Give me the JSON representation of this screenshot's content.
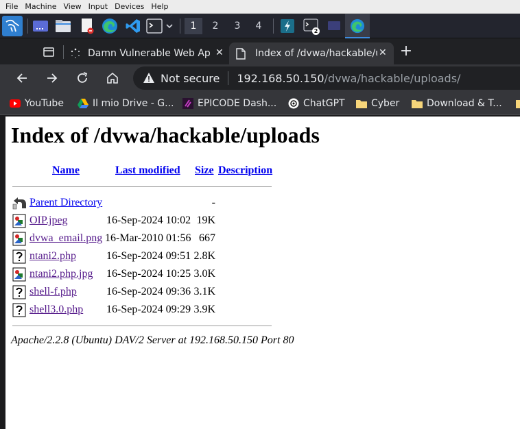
{
  "vm_menu": [
    "File",
    "Machine",
    "View",
    "Input",
    "Devices",
    "Help"
  ],
  "panel": {
    "workspaces": [
      "1",
      "2",
      "3",
      "4"
    ],
    "active_workspace": "1",
    "terminal_badge": "2"
  },
  "browser": {
    "tabs": [
      {
        "title": "Damn Vulnerable Web App"
      },
      {
        "title": "Index of /dvwa/hackable/uploads/"
      }
    ],
    "new_tab": "+",
    "security_label": "Not secure",
    "url_host": "192.168.50.150",
    "url_path": "/dvwa/hackable/uploads/",
    "bookmarks": [
      {
        "label": "YouTube",
        "icon": "youtube-icon"
      },
      {
        "label": "Il mio Drive - G...",
        "icon": "drive-icon"
      },
      {
        "label": "EPICODE Dash...",
        "icon": "epicode-icon"
      },
      {
        "label": "ChatGPT",
        "icon": "chatgpt-icon"
      },
      {
        "label": "Cyber",
        "icon": "folder-icon"
      },
      {
        "label": "Download & T...",
        "icon": "folder-icon"
      }
    ]
  },
  "page": {
    "title": "Index of /dvwa/hackable/uploads",
    "columns": {
      "name": "Name",
      "modified": "Last modified",
      "size": "Size",
      "description": "Description"
    },
    "rows": [
      {
        "name": "Parent Directory",
        "modified": "",
        "size": "-",
        "icon": "back-folder-icon"
      },
      {
        "name": "OIP.jpeg",
        "modified": "16-Sep-2024 10:02",
        "size": "19K",
        "icon": "image-file-icon"
      },
      {
        "name": "dvwa_email.png",
        "modified": "16-Mar-2010 01:56",
        "size": "667",
        "icon": "image-file-icon"
      },
      {
        "name": "ntani2.php",
        "modified": "16-Sep-2024 09:51",
        "size": "2.8K",
        "icon": "unknown-file-icon"
      },
      {
        "name": "ntani2.php.jpg",
        "modified": "16-Sep-2024 10:25",
        "size": "3.0K",
        "icon": "image-file-icon"
      },
      {
        "name": "shell-f.php",
        "modified": "16-Sep-2024 09:36",
        "size": "3.1K",
        "icon": "unknown-file-icon"
      },
      {
        "name": "shell3.0.php",
        "modified": "16-Sep-2024 09:29",
        "size": "3.9K",
        "icon": "unknown-file-icon"
      }
    ],
    "server_signature": "Apache/2.2.8 (Ubuntu) DAV/2 Server at 192.168.50.150 Port 80"
  }
}
